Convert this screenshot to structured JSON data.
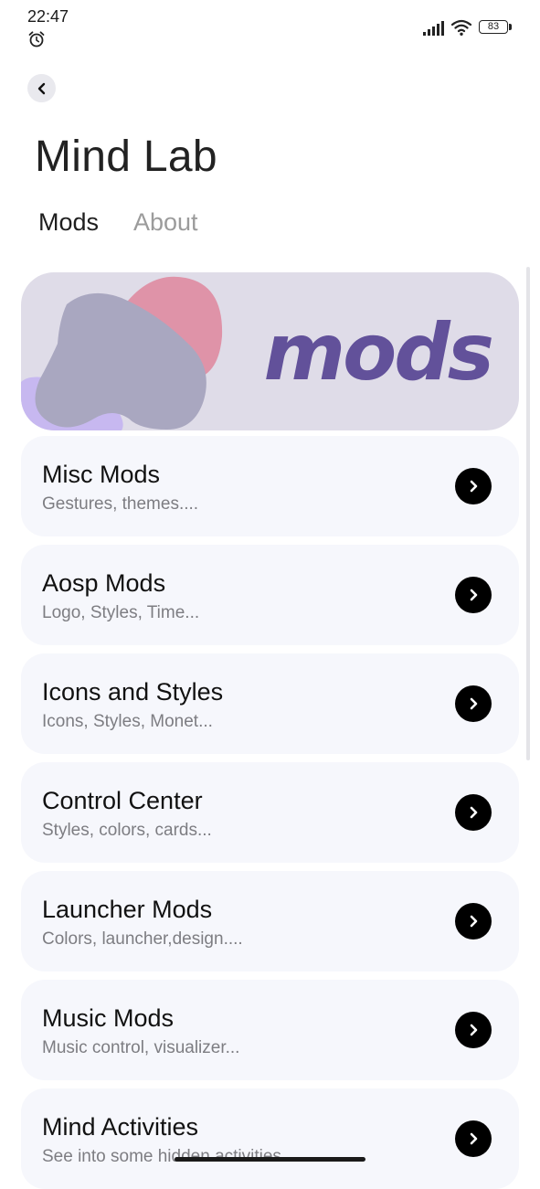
{
  "status_bar": {
    "time": "22:47",
    "battery": "83",
    "icons": [
      "alarm-icon",
      "signal-icon",
      "wifi-icon",
      "battery-icon"
    ]
  },
  "header": {
    "back_icon": "chevron-left-icon",
    "title": "Mind Lab"
  },
  "tabs": [
    {
      "label": "Mods",
      "active": true
    },
    {
      "label": "About",
      "active": false
    }
  ],
  "banner": {
    "text": "mods",
    "text_color": "#62519a",
    "background": "#dfdce8"
  },
  "items": [
    {
      "title": "Misc Mods",
      "subtitle": "Gestures, themes...."
    },
    {
      "title": "Aosp Mods",
      "subtitle": "Logo, Styles, Time..."
    },
    {
      "title": "Icons and Styles",
      "subtitle": "Icons, Styles, Monet..."
    },
    {
      "title": "Control Center",
      "subtitle": "Styles, colors, cards..."
    },
    {
      "title": "Launcher Mods",
      "subtitle": "Colors, launcher,design...."
    },
    {
      "title": "Music Mods",
      "subtitle": "Music control, visualizer..."
    },
    {
      "title": "Mind Activities",
      "subtitle": "See into some hidden activities..."
    }
  ],
  "colors": {
    "card_background": "#f6f7fc",
    "arrow_button": "#000000",
    "inactive_tab": "#9b9b9b"
  }
}
